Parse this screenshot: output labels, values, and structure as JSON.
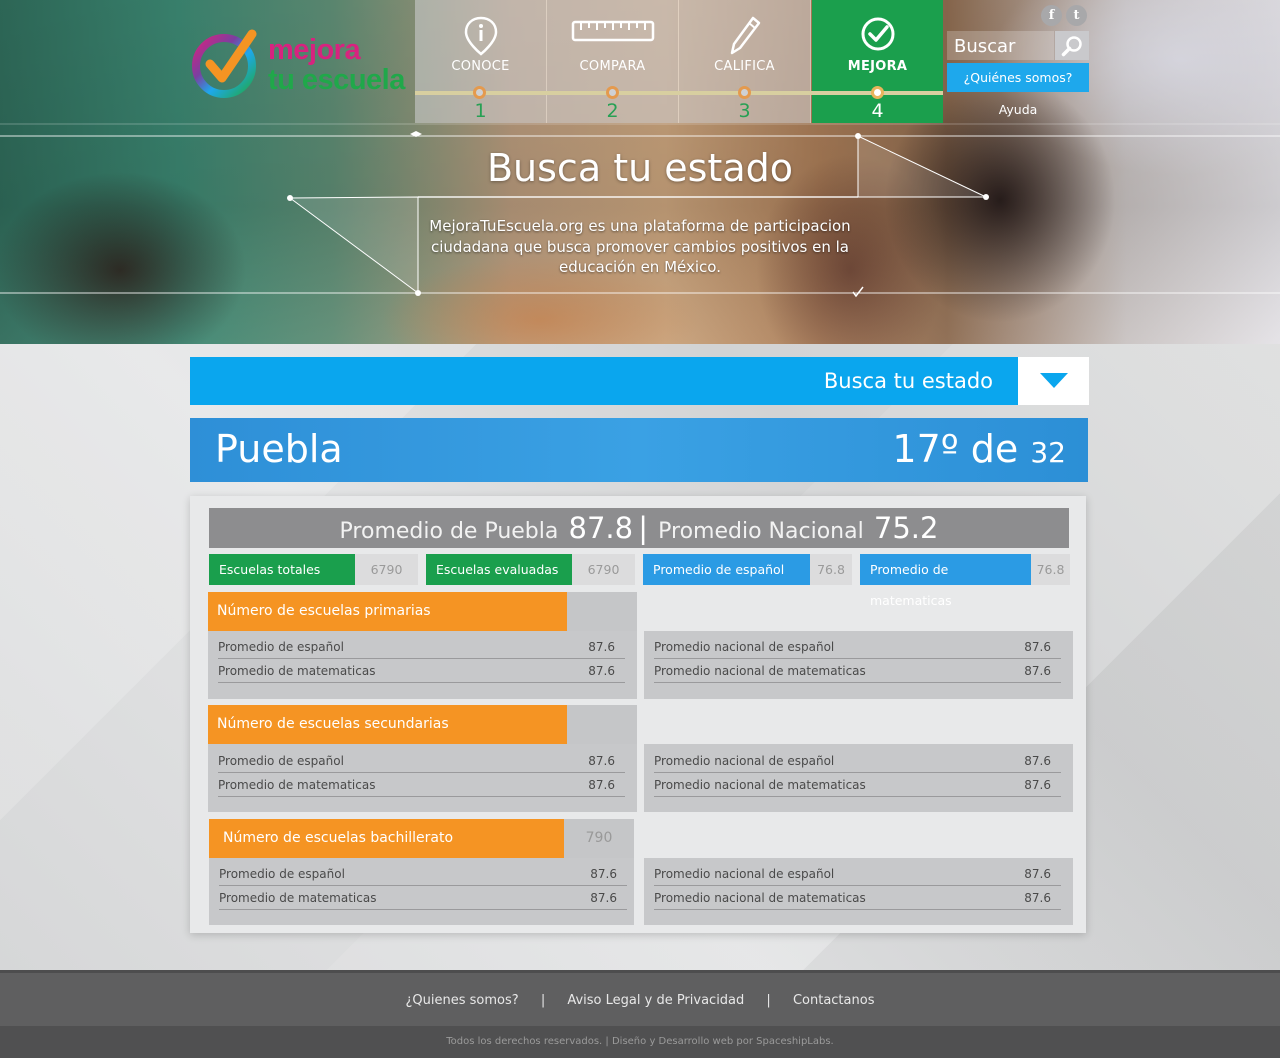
{
  "logo": {
    "line1": "mejora",
    "line2": "tu escuela"
  },
  "steps": [
    {
      "label": "CONOCE",
      "number": "1",
      "icon": "info-pin-icon",
      "active": false
    },
    {
      "label": "COMPARA",
      "number": "2",
      "icon": "ruler-icon",
      "active": false
    },
    {
      "label": "CALIFICA",
      "number": "3",
      "icon": "pencil-icon",
      "active": false
    },
    {
      "label": "MEJORA",
      "number": "4",
      "icon": "check-circle-icon",
      "active": true
    }
  ],
  "header": {
    "search_placeholder": "Buscar",
    "quienes_label": "¿Quiénes somos?",
    "ayuda_label": "Ayuda",
    "social": {
      "facebook": "f",
      "twitter": "t"
    }
  },
  "hero": {
    "title": "Busca tu estado",
    "text": "MejoraTuEscuela.org es una plataforma de participacion ciudadana que busca promover cambios positivos en la educación en México."
  },
  "state_selector": {
    "label": "Busca tu estado"
  },
  "state": {
    "name": "Puebla",
    "rank": "17º de",
    "total": "32"
  },
  "averages": {
    "state_label": "Promedio de Puebla",
    "state_value": "87.8",
    "separator": "|",
    "national_label": "Promedio Nacional",
    "national_value": "75.2"
  },
  "kpis": [
    {
      "label": "Escuelas totales",
      "value": "6790",
      "color": "#1a9f4d"
    },
    {
      "label": "Escuelas evaluadas",
      "value": "6790",
      "color": "#1a9f4d"
    },
    {
      "label": "Promedio de español",
      "value": "76.8",
      "color": "#2b9be4"
    },
    {
      "label": "Promedio de matematicas",
      "value": "76.8",
      "color": "#2b9be4"
    }
  ],
  "sections": [
    {
      "title": "Número de escuelas primarias",
      "value": "",
      "rows": [
        {
          "label": "Promedio de español",
          "value": "87.6"
        },
        {
          "label": "Promedio de matematicas",
          "value": "87.6"
        }
      ],
      "national_rows": [
        {
          "label": "Promedio nacional de español",
          "value": "87.6"
        },
        {
          "label": "Promedio nacional de matematicas",
          "value": "87.6"
        }
      ]
    },
    {
      "title": "Número  de escuelas secundarias",
      "value": "",
      "rows": [
        {
          "label": "Promedio de español",
          "value": "87.6"
        },
        {
          "label": "Promedio de matematicas",
          "value": "87.6"
        }
      ],
      "national_rows": [
        {
          "label": "Promedio nacional de español",
          "value": "87.6"
        },
        {
          "label": "Promedio nacional de matematicas",
          "value": "87.6"
        }
      ]
    },
    {
      "title": "Número de escuelas bachillerato",
      "value": "790",
      "rows": [
        {
          "label": "Promedio de español",
          "value": "87.6"
        },
        {
          "label": "Promedio de matematicas",
          "value": "87.6"
        }
      ],
      "national_rows": [
        {
          "label": "Promedio nacional de español",
          "value": "87.6"
        },
        {
          "label": "Promedio nacional de matematicas",
          "value": "87.6"
        }
      ]
    }
  ],
  "footer": {
    "links": [
      "¿Quienes somos?",
      "Aviso Legal  y  de Privacidad",
      "Contactanos"
    ],
    "separator": "|",
    "copyright": "Todos los derechos reservados. | Diseño y Desarrollo web por SpaceshipLabs."
  },
  "colors": {
    "accent_blue": "#0aa6ee",
    "green": "#1a9f4d",
    "orange": "#f59423",
    "state_blue": "#2e8fd7"
  }
}
